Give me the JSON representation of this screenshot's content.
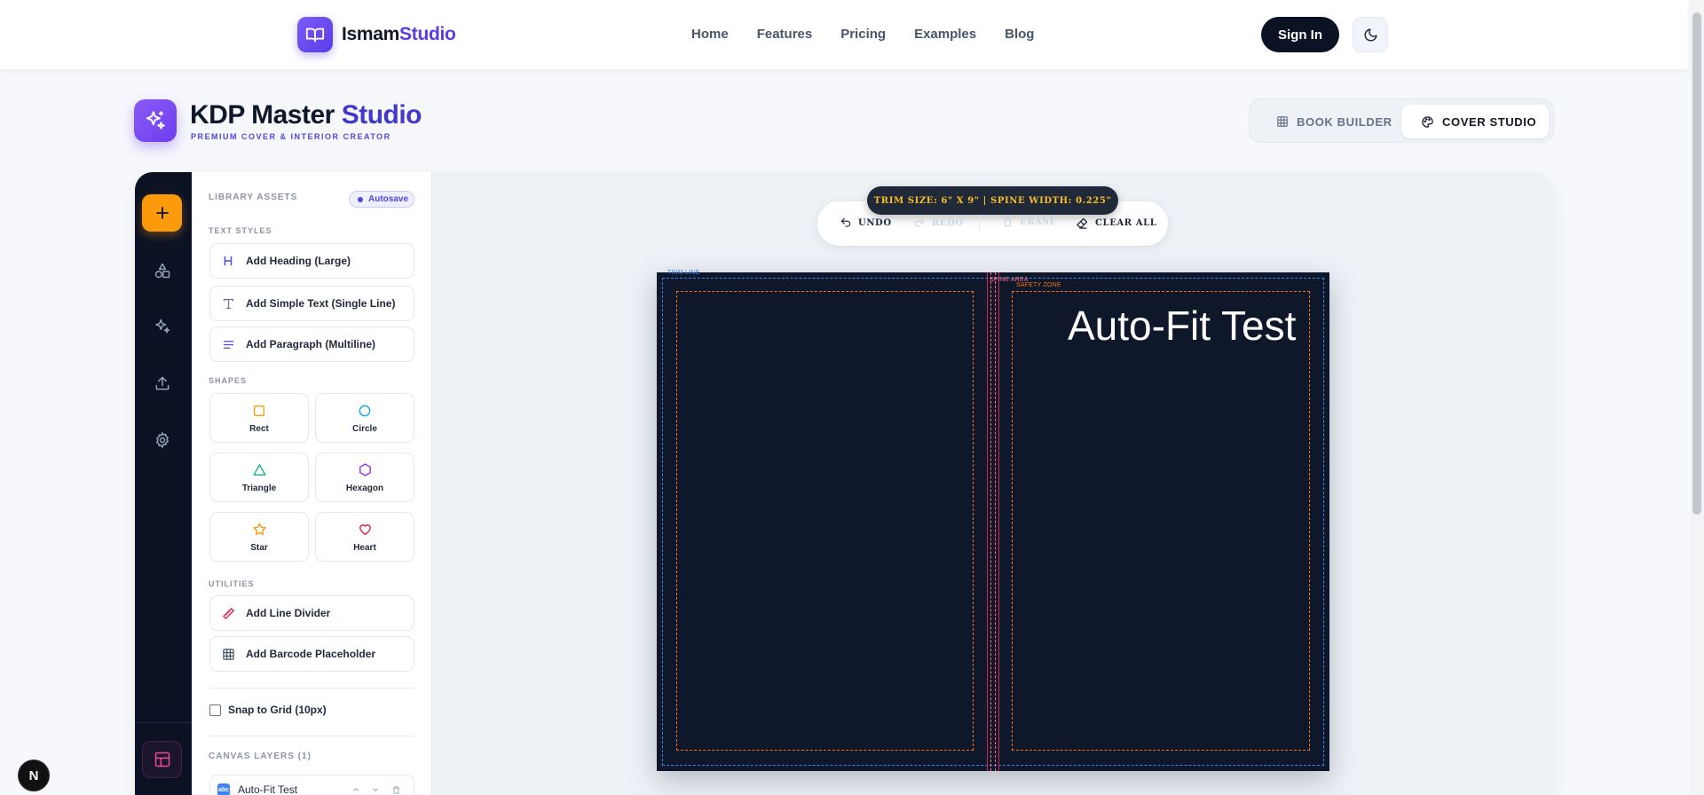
{
  "nav": {
    "brand_a": "Ismam",
    "brand_b": "Studio",
    "links": [
      "Home",
      "Features",
      "Pricing",
      "Examples",
      "Blog"
    ],
    "signin": "Sign In"
  },
  "header": {
    "title_a": "KDP Master",
    "title_b": "Studio",
    "subtitle": "PREMIUM COVER & INTERIOR CREATOR",
    "modes": {
      "book": "BOOK BUILDER",
      "cover": "COVER STUDIO"
    },
    "active_mode": "cover"
  },
  "panel": {
    "library_label": "LIBRARY ASSETS",
    "autosave": "Autosave",
    "text_styles_label": "TEXT STYLES",
    "text_styles": [
      "Add Heading (Large)",
      "Add Simple Text (Single Line)",
      "Add Paragraph (Multiline)"
    ],
    "shapes_label": "SHAPES",
    "shapes": [
      "Rect",
      "Circle",
      "Triangle",
      "Hexagon",
      "Star",
      "Heart"
    ],
    "utilities_label": "UTILITIES",
    "utilities": [
      "Add Line Divider",
      "Add Barcode Placeholder"
    ],
    "snap": "Snap to Grid (10px)",
    "layers_label": "CANVAS LAYERS (1)",
    "layers": [
      "Auto-Fit Test"
    ]
  },
  "canvas": {
    "trim_info": "TRIM SIZE: 6\" X 9\" | SPINE WIDTH: 0.225\"",
    "toolbar": {
      "undo": "UNDO",
      "redo": "REDO",
      "erase": "ERASE",
      "clear": "CLEAR ALL"
    },
    "guides": {
      "trim": "TRIM LINE",
      "spine": "SPINE AREA",
      "safety": "SAFETY ZONE"
    },
    "cover_text": "Auto-Fit Test"
  },
  "colors": {
    "accent": "#5b3be8",
    "cover_bg": "#0f172a",
    "rail_bg": "#0b1224",
    "add_button": "#fb9b0b",
    "bleed_guide": "#3b82f6",
    "safe_guide": "#f97316",
    "spine_guide": "#e11d48"
  },
  "misc": {
    "framework_badge": "N"
  }
}
